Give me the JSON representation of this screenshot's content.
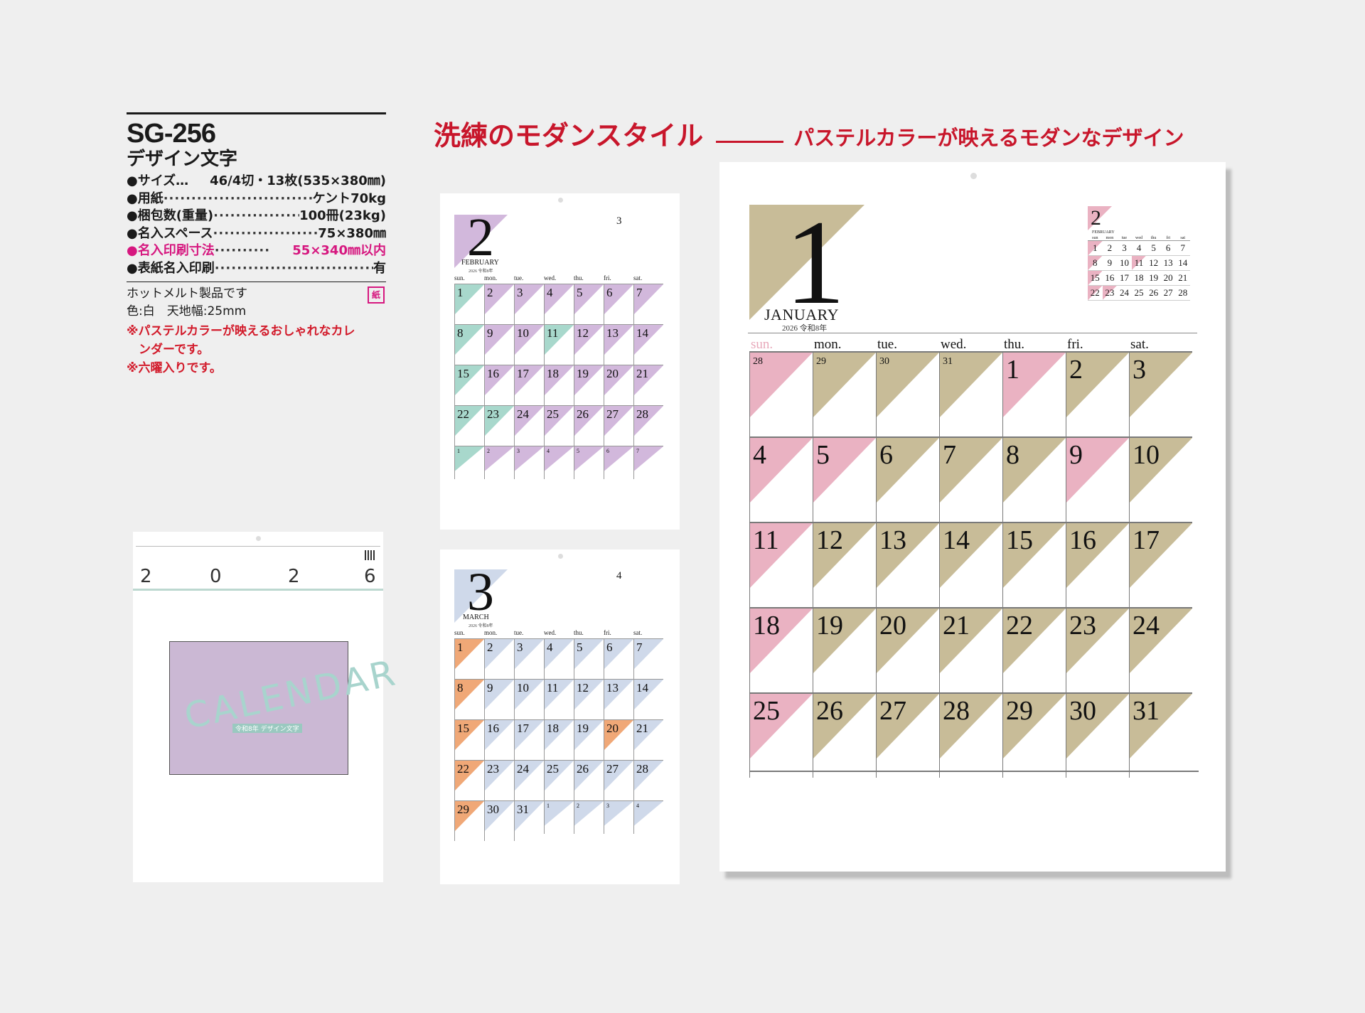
{
  "product": {
    "code": "SG-256",
    "name": "デザイン文字",
    "specs": [
      {
        "label": "●サイズ…",
        "dots": "",
        "value": " 46/4切・13枚(535×380㎜)"
      },
      {
        "label": "●用紙",
        "dots": "·································",
        "value": "ケント70kg"
      },
      {
        "label": "●梱包数(重量)",
        "dots": "··················",
        "value": "100冊(23kg)"
      },
      {
        "label": "●名入スペース",
        "dots": "··························",
        "value": "75×380㎜"
      },
      {
        "label": "●名入印刷寸法",
        "dots": "··········",
        "value": "55×340㎜以内",
        "highlight": true
      },
      {
        "label": "●表紙名入印刷",
        "dots": "··································",
        "value": "有"
      }
    ],
    "notes": [
      "ホットメルト製品です",
      "色:白　天地幅:25mm"
    ],
    "badge": "紙",
    "features": [
      "※パステルカラーが映えるおしゃれなカレ",
      "　ンダーです。",
      "※六曜入りです。"
    ]
  },
  "headline": {
    "main": "洗練のモダンスタイル",
    "sub": "パステルカラーが映えるモダンなデザイン"
  },
  "cover": {
    "year_digits": [
      "2",
      "0",
      "2",
      "6"
    ],
    "word": "CALENDAR",
    "sub_label": "令和8年 デザイン文字"
  },
  "weekdays": [
    "sun.",
    "mon.",
    "tue.",
    "wed.",
    "thu.",
    "fri.",
    "sat."
  ],
  "colors": {
    "january_accent": "#c8bc98",
    "january_holiday": "#eab2c2",
    "february_accent": "#d2b8dc",
    "february_holiday": "#a8d8cc",
    "march_accent": "#cfd9ea",
    "march_holiday": "#f0a877"
  },
  "january": {
    "number": "1",
    "name": "JANUARY",
    "year": "2026 令和8年",
    "next_month": {
      "number": "2",
      "name": "FEBRUARY",
      "weeks": [
        [
          "1",
          "2",
          "3",
          "4",
          "5",
          "6",
          "7"
        ],
        [
          "8",
          "9",
          "10",
          "11",
          "12",
          "13",
          "14"
        ],
        [
          "15",
          "16",
          "17",
          "18",
          "19",
          "20",
          "21"
        ],
        [
          "22",
          "23",
          "24",
          "25",
          "26",
          "27",
          "28"
        ]
      ]
    },
    "days": [
      "28",
      "29",
      "30",
      "31",
      "1",
      "2",
      "3",
      "4",
      "5",
      "6",
      "7",
      "8",
      "9",
      "10",
      "11",
      "12",
      "13",
      "14",
      "15",
      "16",
      "17",
      "18",
      "19",
      "20",
      "21",
      "22",
      "23",
      "24",
      "25",
      "26",
      "27",
      "28",
      "29",
      "30",
      "31"
    ]
  },
  "february": {
    "number": "2",
    "name": "FEBRUARY",
    "year": "2026 令和8年",
    "next_month_number": "3",
    "days": [
      "1",
      "2",
      "3",
      "4",
      "5",
      "6",
      "7",
      "8",
      "9",
      "10",
      "11",
      "12",
      "13",
      "14",
      "15",
      "16",
      "17",
      "18",
      "19",
      "20",
      "21",
      "22",
      "23",
      "24",
      "25",
      "26",
      "27",
      "28",
      "1",
      "2",
      "3",
      "4",
      "5",
      "6",
      "7"
    ]
  },
  "march": {
    "number": "3",
    "name": "MARCH",
    "year": "2026 令和8年",
    "next_month_number": "4",
    "days": [
      "1",
      "2",
      "3",
      "4",
      "5",
      "6",
      "7",
      "8",
      "9",
      "10",
      "11",
      "12",
      "13",
      "14",
      "15",
      "16",
      "17",
      "18",
      "19",
      "20",
      "21",
      "22",
      "23",
      "24",
      "25",
      "26",
      "27",
      "28",
      "29",
      "30",
      "31",
      "1",
      "2",
      "3",
      "4"
    ]
  }
}
